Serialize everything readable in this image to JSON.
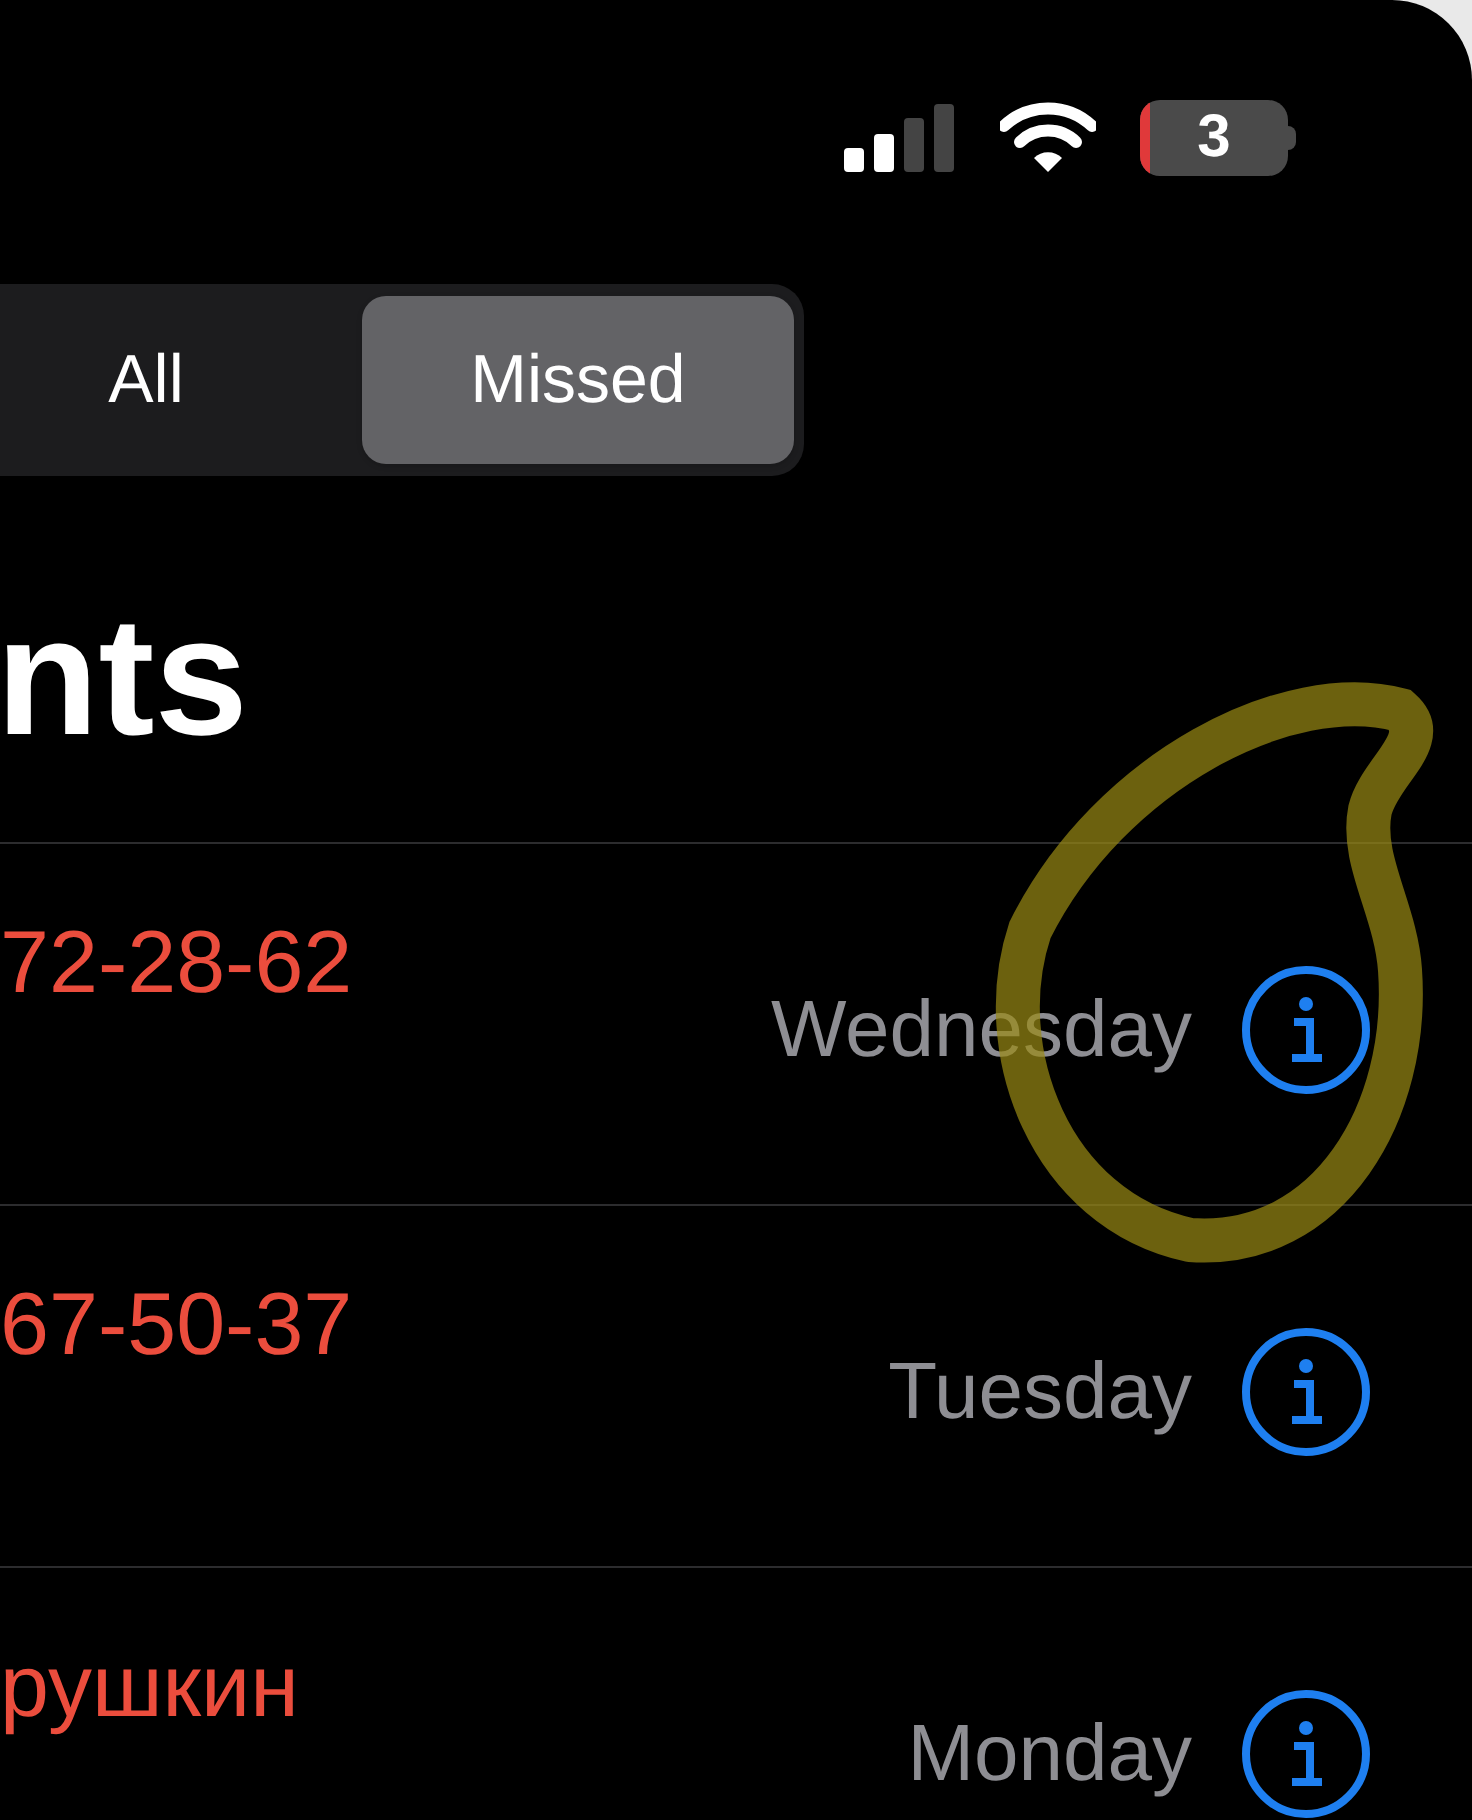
{
  "status_bar": {
    "battery": "3"
  },
  "segments": [
    {
      "label": "All",
      "selected": false
    },
    {
      "label": "Missed",
      "selected": true
    }
  ],
  "title": "nts",
  "calls": [
    {
      "name": "72-28-62",
      "missed": true,
      "date": "Wednesday"
    },
    {
      "name": "67-50-37",
      "missed": true,
      "date": "Tuesday"
    },
    {
      "name": "рушкин",
      "missed": true,
      "date": "Monday"
    }
  ]
}
